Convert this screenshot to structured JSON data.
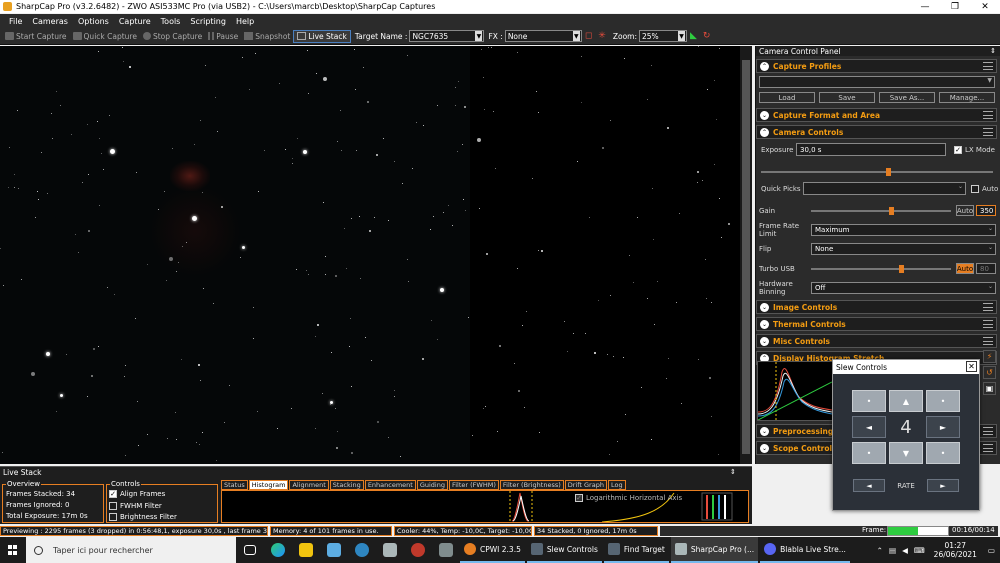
{
  "window": {
    "title": "SharpCap Pro (v3.2.6482) - ZWO ASI533MC Pro (via USB2) - C:\\Users\\marcb\\Desktop\\SharpCap Captures",
    "minimize": "—",
    "maximize": "❐",
    "close": "✕"
  },
  "menu": [
    "File",
    "Cameras",
    "Options",
    "Capture",
    "Tools",
    "Scripting",
    "Help"
  ],
  "toolbar": {
    "start_capture": "Start Capture",
    "quick_capture": "Quick Capture",
    "stop_capture": "Stop Capture",
    "pause": "Pause",
    "snapshot": "Snapshot",
    "live_stack": "Live Stack",
    "target_label": "Target Name :",
    "target_value": "NGC7635",
    "fx_label": "FX :",
    "fx_value": "None",
    "zoom_label": "Zoom:",
    "zoom_value": "25%"
  },
  "ccp": {
    "title": "Camera Control Panel",
    "pin": "⇕",
    "sections": {
      "capture_profiles": "Capture Profiles",
      "capture_format": "Capture Format and Area",
      "camera_controls": "Camera Controls",
      "image_controls": "Image Controls",
      "thermal_controls": "Thermal Controls",
      "misc_controls": "Misc Controls",
      "display_histogram": "Display Histogram Stretch",
      "preprocessing": "Preprocessing",
      "scope_controls": "Scope Controls"
    },
    "profile_buttons": {
      "load": "Load",
      "save": "Save",
      "save_as": "Save As...",
      "manage": "Manage..."
    },
    "exposure": {
      "label": "Exposure",
      "value": "30,0 s",
      "lx_label": "LX Mode",
      "lx_checked": "✓",
      "slider_level": 0.55
    },
    "quick_picks": {
      "label": "Quick Picks",
      "auto_label": "Auto"
    },
    "gain": {
      "label": "Gain",
      "auto_label": "Auto",
      "value": "350",
      "slider_level": 0.58
    },
    "frame_rate": {
      "label_1": "Frame Rate",
      "label_2": "Limit",
      "value": "Maximum"
    },
    "flip": {
      "label": "Flip",
      "value": "None"
    },
    "turbo_usb": {
      "label": "Turbo USB",
      "auto_label": "Auto",
      "value": "80",
      "slider_level": 0.65
    },
    "binning": {
      "label_1": "Hardware",
      "label_2": "Binning",
      "value": "Off"
    }
  },
  "slew": {
    "title": "Slew Controls",
    "close": "✕",
    "up": "▲",
    "down": "▼",
    "left": "◄",
    "right": "►",
    "diag": "•",
    "rate_value": "4",
    "rate_label": "RATE",
    "rate_down": "◄",
    "rate_up": "►"
  },
  "live_stack": {
    "title": "Live Stack",
    "pin": "⇕",
    "overview_legend": "Overview",
    "frames_stacked": "Frames Stacked: 34",
    "frames_ignored": "Frames Ignored:  0",
    "total_exposure": "Total Exposure:   17m 0s",
    "controls_legend": "Controls",
    "align_frames": "Align Frames",
    "align_checked": "✓",
    "fwhm_filter": "FWHM Filter",
    "brightness_filter": "Brightness Filter",
    "tabs": [
      "Status",
      "Histogram",
      "Alignment",
      "Stacking",
      "Enhancement",
      "Guiding",
      "Filter (FWHM)",
      "Filter (Brightness)",
      "Drift Graph",
      "Log"
    ],
    "active_tab": "Histogram",
    "log_axis_label": "Logarithmic Horizontal Axis",
    "log_axis_checked": "✓"
  },
  "status": {
    "previewing": "Previewing : 2295 frames (3 dropped) in 0:56:48,1, exposure 30,0s , last frame 31,0",
    "memory": "Memory: 4 of 101 frames in use.",
    "cooler": "Cooler: 44%, Temp: -10,0C, Target: -10,0C",
    "stacked": "34 Stacked, 0 Ignored, 17m 0s",
    "frame_label": "Frame:",
    "frame_progress": 0.5,
    "frame_time": "00:16/00:14"
  },
  "taskbar": {
    "search_placeholder": "Taper ici pour rechercher",
    "tasks": [
      "CPWI 2.3.5",
      "Slew Controls",
      "Find Target",
      "SharpCap Pro (...",
      "Blabla Live Stre..."
    ],
    "time": "01:27",
    "date": "26/06/2021"
  }
}
